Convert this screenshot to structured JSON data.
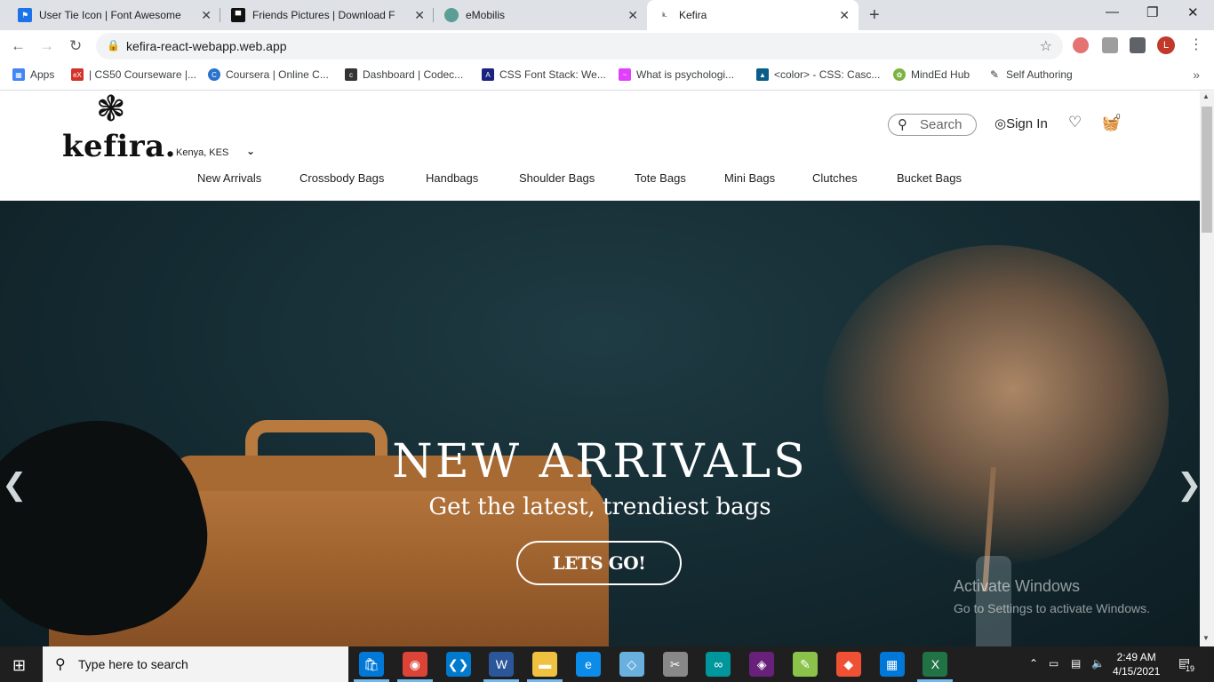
{
  "browser": {
    "tabs": [
      {
        "title": "User Tie Icon | Font Awesome",
        "icon": "flag-icon",
        "color": "#1a73e8"
      },
      {
        "title": "Friends Pictures | Download Free",
        "icon": "unsplash-icon",
        "color": "#111111"
      },
      {
        "title": "eMobilis",
        "icon": "emobilis-icon",
        "color": "#5a9e95"
      },
      {
        "title": "Kefira",
        "icon": "kefira-icon",
        "color": "#444444",
        "active": true
      }
    ],
    "new_tab": "+",
    "window": {
      "minimize": "—",
      "maximize": "❐",
      "close": "✕"
    },
    "toolbar": {
      "back": "←",
      "forward": "→",
      "reload": "↻",
      "url": "kefira-react-webapp.web.app",
      "profile_initial": "L"
    },
    "bookmarks": [
      {
        "label": "Apps",
        "icon": "apps-grid-icon",
        "color": "#4285f4"
      },
      {
        "label": "| CS50 Courseware |...",
        "icon": "edx-icon",
        "color": "#d23228"
      },
      {
        "label": "Coursera | Online C...",
        "icon": "coursera-icon",
        "color": "#2a73cc"
      },
      {
        "label": "Dashboard | Codec...",
        "icon": "codecademy-icon",
        "color": "#333333"
      },
      {
        "label": "CSS Font Stack: We...",
        "icon": "cssfontstack-icon",
        "color": "#1a237e"
      },
      {
        "label": "What is psychologi...",
        "icon": "psych-icon",
        "color": "#e040fb"
      },
      {
        "label": "<color> - CSS: Casc...",
        "icon": "mdn-icon",
        "color": "#0a5c8a"
      },
      {
        "label": "MindEd Hub",
        "icon": "minded-icon",
        "color": "#7cb342"
      },
      {
        "label": "Self Authoring",
        "icon": "pen-icon",
        "color": "#333333"
      }
    ],
    "bookmarks_more": "»"
  },
  "site": {
    "logo": "kefira.",
    "region": "Kenya, KES",
    "search_placeholder": "Search",
    "signin": "Sign In",
    "cart_count": "0",
    "nav": [
      "New Arrivals",
      "Crossbody Bags",
      "Handbags",
      "Shoulder Bags",
      "Tote Bags",
      "Mini Bags",
      "Clutches",
      "Bucket Bags"
    ],
    "hero": {
      "title": "NEW ARRIVALS",
      "subtitle": "Get the latest, trendiest bags",
      "button": "LETS GO!",
      "prev": "❮",
      "next": "❯"
    },
    "watermark": {
      "line1": "Activate Windows",
      "line2": "Go to Settings to activate Windows."
    }
  },
  "taskbar": {
    "search_placeholder": "Type here to search",
    "time": "2:49 AM",
    "date": "4/15/2021",
    "notifications": "19",
    "apps": [
      {
        "name": "store-icon",
        "color": "#0078d7"
      },
      {
        "name": "chrome-icon",
        "color": "#db4437"
      },
      {
        "name": "vscode-icon",
        "color": "#007acc"
      },
      {
        "name": "word-icon",
        "color": "#2b579a"
      },
      {
        "name": "file-explorer-icon",
        "color": "#f0c040"
      },
      {
        "name": "edge-icon",
        "color": "#0c8ce9"
      },
      {
        "name": "notepad-icon",
        "color": "#6ab0de"
      },
      {
        "name": "snipping-icon",
        "color": "#888888"
      },
      {
        "name": "arduino-icon",
        "color": "#00979c"
      },
      {
        "name": "visual-studio-icon",
        "color": "#68217a"
      },
      {
        "name": "notepadpp-icon",
        "color": "#8bc34a"
      },
      {
        "name": "git-icon",
        "color": "#f05033"
      },
      {
        "name": "calendar-icon",
        "color": "#0078d7"
      },
      {
        "name": "excel-icon",
        "color": "#217346"
      }
    ]
  }
}
